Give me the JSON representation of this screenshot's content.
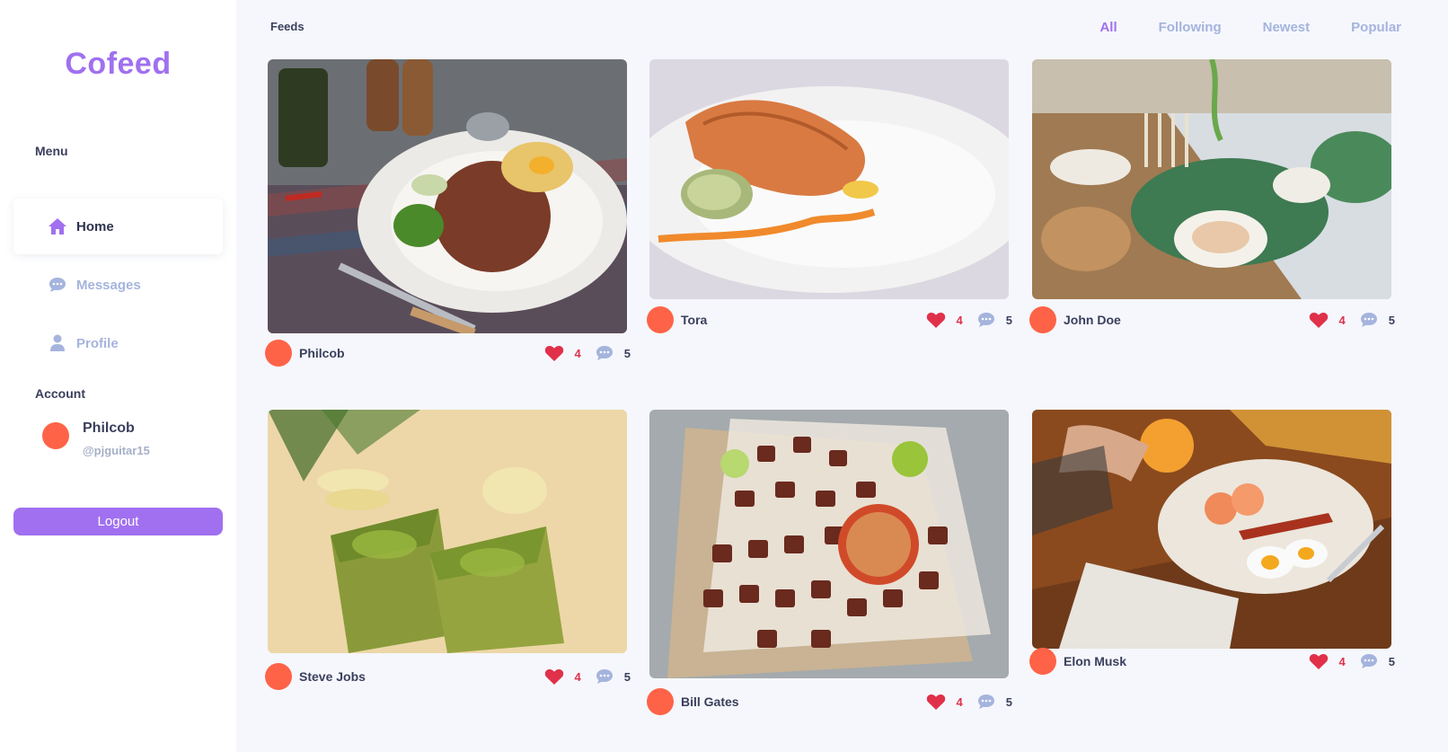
{
  "app": {
    "name": "Cofeed"
  },
  "sidebar": {
    "menu_label": "Menu",
    "items": [
      {
        "label": "Home",
        "icon": "home-icon",
        "active": true
      },
      {
        "label": "Messages",
        "icon": "chat-icon",
        "active": false
      },
      {
        "label": "Profile",
        "icon": "user-icon",
        "active": false
      }
    ],
    "account_label": "Account",
    "account": {
      "name": "Philcob",
      "handle": "@pjguitar15"
    },
    "logout_label": "Logout"
  },
  "main": {
    "title": "Feeds",
    "filters": [
      {
        "label": "All",
        "active": true
      },
      {
        "label": "Following",
        "active": false
      },
      {
        "label": "Newest",
        "active": false
      },
      {
        "label": "Popular",
        "active": false
      }
    ],
    "posts": [
      {
        "author": "Philcob",
        "likes": "4",
        "comments": "5",
        "image": "grilled pork plate"
      },
      {
        "author": "Tora",
        "likes": "4",
        "comments": "5",
        "image": "salmon fillet plate"
      },
      {
        "author": "John Doe",
        "likes": "4",
        "comments": "5",
        "image": "dinner table spread"
      },
      {
        "author": "Steve Jobs",
        "likes": "4",
        "comments": "5",
        "image": "matcha drinks"
      },
      {
        "author": "Bill Gates",
        "likes": "4",
        "comments": "5",
        "image": "tofu skewers"
      },
      {
        "author": "Elon Musk",
        "likes": "4",
        "comments": "5",
        "image": "breakfast with newspaper"
      }
    ]
  },
  "colors": {
    "accent": "#a070f0",
    "avatar": "#ff6347",
    "like": "#e0304a",
    "muted": "#a5b4dd",
    "text": "#3a3f5c"
  }
}
